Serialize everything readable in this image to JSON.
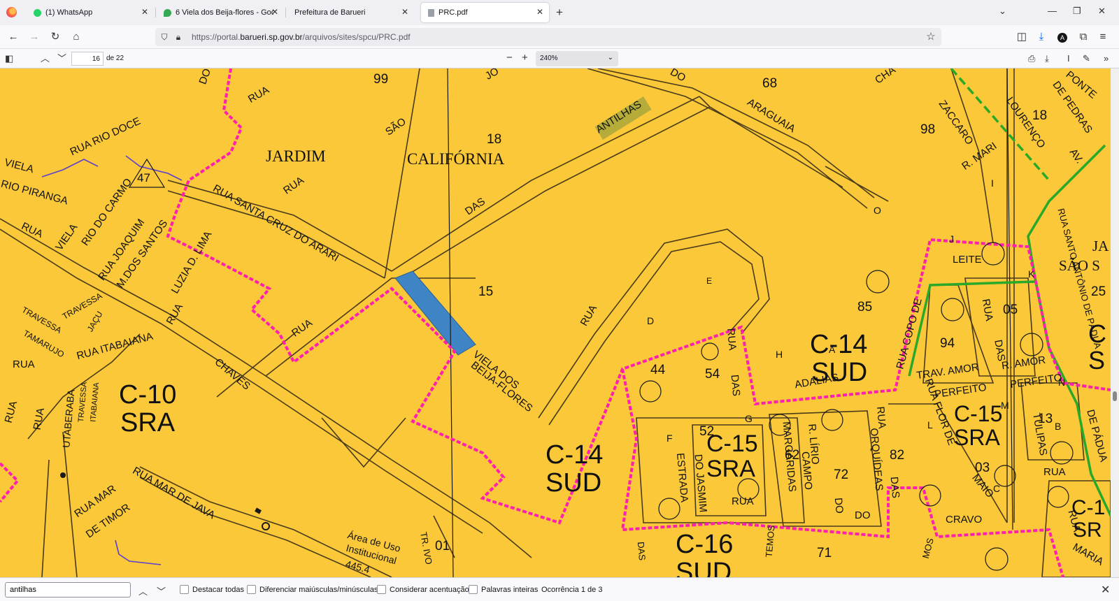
{
  "browser": {
    "tabs": [
      {
        "label": "(1) WhatsApp",
        "favicon_color": "#25d366"
      },
      {
        "label": "6 Viela dos Beija-flores - Google",
        "favicon_color": "#34a853"
      },
      {
        "label": "Prefeitura de Barueri",
        "favicon_color": ""
      },
      {
        "label": "PRC.pdf",
        "favicon_color": "#9aa0a6"
      }
    ],
    "url_prefix": "https://portal.",
    "url_domain": "barueri.sp.gov.br",
    "url_path": "/arquivos/sites/spcu/PRC.pdf"
  },
  "pdf_toolbar": {
    "page_number": "16",
    "page_count": "de 22",
    "zoom": "240%"
  },
  "find_bar": {
    "query": "antilhas",
    "highlight_all": "Destacar todas",
    "match_case": "Diferenciar maiúsculas/minúsculas",
    "match_diacritics": "Considerar acentuação",
    "whole_words": "Palavras inteiras",
    "status": "Ocorrência 1 de 3"
  },
  "map": {
    "neighborhood_labels": [
      "JARDIM",
      "CALIFÓRNIA",
      "JA",
      "SÃO S"
    ],
    "zones": [
      "C-10",
      "SRA",
      "C-14",
      "SUD",
      "C-14",
      "SUD",
      "C-15",
      "SRA",
      "C-15",
      "SRA",
      "C-16",
      "SUD",
      "C-1",
      "SR",
      "C",
      "S"
    ],
    "block_numbers": [
      "99",
      "68",
      "18",
      "98",
      "18",
      "15",
      "85",
      "94",
      "05",
      "25",
      "44",
      "54",
      "52",
      "62",
      "72",
      "82",
      "13",
      "03",
      "71",
      "01",
      "47"
    ],
    "street_labels": [
      "RUA",
      "SÃO",
      "RUA RIO DOCE",
      "VIELA",
      "RIO PIRANGA",
      "RUA",
      "VIELA",
      "RIO DO CARMO",
      "RUA JOAQUIM",
      "M.DOS SANTOS",
      "RUA SANTA CRUZ DO ARARI",
      "RUA",
      "DAS",
      "ANTILHAS",
      "ARAGUAIA",
      "ZACCARO",
      "R. MARI",
      "LOURENÇO",
      "DE PEDRAS",
      "PONTE",
      "AV.",
      "RUA",
      "LUZIA D. LIMA",
      "RUA",
      "TRAVESSA",
      "TRAVESSA",
      "JAÇU",
      "TAMARUJO",
      "RUA",
      "RUA ITABAIANA",
      "CHAVES",
      "RUA",
      "VIELA DOS",
      "BEIJA-FLORES",
      "RUA",
      "UTABERABA",
      "TRAVESSA",
      "ITABAIANA",
      "RUA MAR",
      "DE TIMOR",
      "RUA MAR DE JAVA",
      "Área de Uso",
      "Institucional",
      "445.4",
      "TR. IVO",
      "LEITE",
      "RUA COPO DE",
      "ADALIAS",
      "TRAV. AMOR",
      "PERFEITO",
      "PERFEITO",
      "R. AMOR",
      "RUA FLOR DE",
      "MAIO",
      "RUA SANTO ANTÔNIO DE PÁDUA",
      "DE PÁDUA",
      "TULIPAS",
      "RUA",
      "RUA",
      "DAS",
      "RUA",
      "DAS",
      "ESTRADA",
      "DO JASMIM",
      "RUA",
      "MARGARIDAS",
      "CAMPO",
      "R. LÍRIO",
      "DO",
      "ORQUÍDEAS",
      "DO",
      "RUA",
      "DAS",
      "CRAVO",
      "RUA",
      "MARIA",
      "DAS",
      "TEMOS",
      "MOS",
      "DO",
      "JO",
      "CHA",
      "DO",
      "RUA"
    ],
    "circle_letters": [
      "O",
      "J",
      "K",
      "I",
      "E",
      "D",
      "H",
      "A",
      "F",
      "G",
      "L",
      "M",
      "N",
      "B",
      "C"
    ],
    "colors": {
      "land": "#fac838",
      "zone_boundary": "#ff1fb0",
      "parcel": "#3f85c6",
      "road_outline": "#4a3b1a",
      "green_route": "#29a829"
    }
  }
}
